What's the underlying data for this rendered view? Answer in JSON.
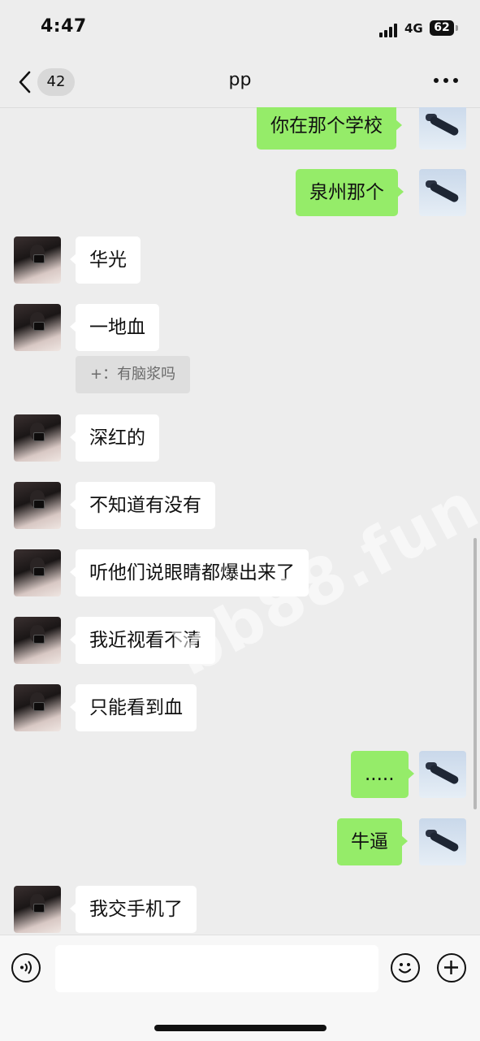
{
  "status_bar": {
    "time": "4:47",
    "network": "4G",
    "battery": "62"
  },
  "nav": {
    "unread_count": "42",
    "title": "pp"
  },
  "messages": [
    {
      "side": "out",
      "text": "你在那个学校"
    },
    {
      "side": "out",
      "text": "泉州那个"
    },
    {
      "side": "in",
      "text": "华光"
    },
    {
      "side": "in",
      "text": "一地血"
    },
    {
      "side": "in",
      "text": "深红的"
    },
    {
      "side": "in",
      "text": "不知道有没有"
    },
    {
      "side": "in",
      "text": "听他们说眼睛都爆出来了"
    },
    {
      "side": "in",
      "text": "我近视看不清"
    },
    {
      "side": "in",
      "text": "只能看到血"
    },
    {
      "side": "out",
      "text": "....."
    },
    {
      "side": "out",
      "text": "牛逼"
    },
    {
      "side": "in",
      "text": "我交手机了"
    }
  ],
  "quote": {
    "text": "+：有脑浆吗"
  },
  "watermark": "bb88.fun",
  "input": {
    "placeholder": ""
  },
  "colors": {
    "out_bubble": "#95ec69",
    "in_bubble": "#ffffff",
    "background": "#ededed"
  }
}
